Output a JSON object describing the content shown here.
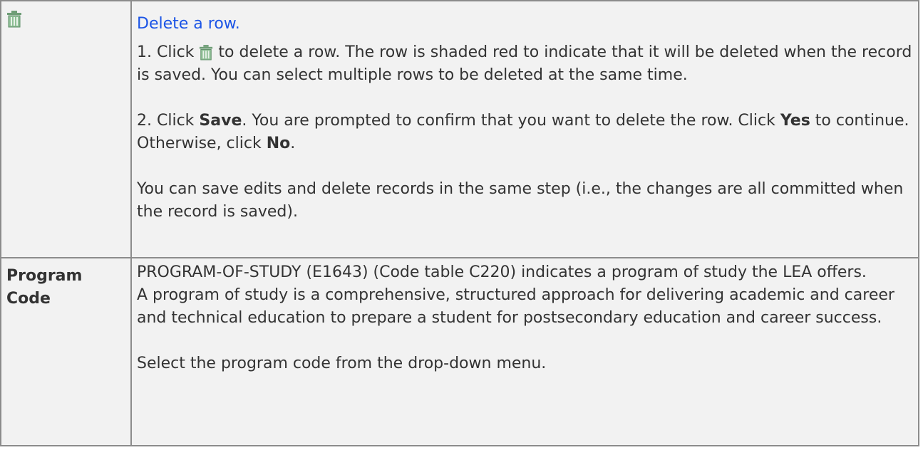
{
  "rows": [
    {
      "icon": "trash-icon",
      "link": "Delete a row.",
      "step1": {
        "before": "1. Click",
        "after": "to delete a row. The row is shaded red to indicate that it will be deleted when the record is saved. You can select multiple rows to be deleted at the same time."
      },
      "step2": {
        "a": "2. Click",
        "save": "Save",
        "b": ". You are prompted to confirm that you want to delete the row. Click",
        "yes": "Yes",
        "c": "to continue. Otherwise, click",
        "no": "No",
        "d": "."
      },
      "note": "You can save edits and delete records in the same step (i.e., the changes are all committed when the record is saved)."
    },
    {
      "label": "Program Code",
      "desc1": "PROGRAM-OF-STUDY (E1643) (Code table C220) indicates a program of study the LEA offers.",
      "desc2": "A program of study is a comprehensive, structured approach for delivering academic and career and technical education to prepare a student for postsecondary education and career success.",
      "desc3": "Select the program code from the drop-down menu."
    }
  ],
  "colors": {
    "link": "#1b54e6",
    "icon": "#6f9e77",
    "border": "#8c8c8c",
    "cell_bg": "#f2f2f2"
  }
}
